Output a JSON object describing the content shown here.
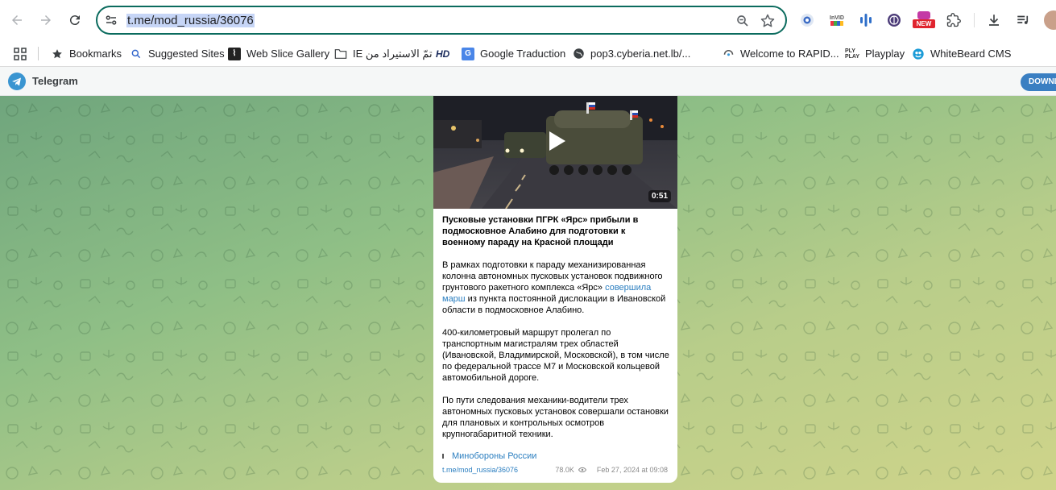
{
  "browser": {
    "url": "t.me/mod_russia/36076",
    "extensions": [
      "target-icon",
      "invid-icon",
      "audio-bars-icon",
      "tor-icon",
      "new-badge-icon",
      "puzzle-icon"
    ],
    "new_badge": "NEW",
    "invid_label": "InVID"
  },
  "bookmarks": [
    {
      "label": "Bookmarks",
      "icon": "star-icon"
    },
    {
      "label": "Suggested Sites",
      "icon": "search-icon"
    },
    {
      "label": "Web Slice Gallery",
      "icon": "slice-icon"
    },
    {
      "label": "تمّ الاستيراد من IE",
      "icon": "folder-icon"
    },
    {
      "label": "",
      "icon": "hd-icon",
      "badge": "HD"
    },
    {
      "label": "Google Traduction",
      "icon": "translate-icon"
    },
    {
      "label": "pop3.cyberia.net.lb/...",
      "icon": "globe-icon"
    },
    {
      "label": "Welcome to RAPID...",
      "icon": "rapid-icon"
    },
    {
      "label": "Playplay",
      "icon": "playplay-icon"
    },
    {
      "label": "WhiteBeard CMS",
      "icon": "whitebeard-icon"
    }
  ],
  "telegram": {
    "brand": "Telegram",
    "download": "DOWNLOAD"
  },
  "post": {
    "duration": "0:51",
    "title": "Пусковые установки ПГРК «Ярс» прибыли в подмосковное Алабино для подготовки к военному параду на Красной площади",
    "p1_before": "В рамках подготовки к параду механизированная колонна автономных пусковых установок подвижного грунтового ракетного комплекса «Ярс» ",
    "p1_link": "совершила марш",
    "p1_after": " из пункта постоянной дислокации в Ивановской области в подмосковное Алабино.",
    "p2": "400-километровый маршрут пролегал по транспортным магистралям трех областей (Ивановской, Владимирской, Московской), в том числе по федеральной трассе М7 и Московской кольцевой автомобильной дороге.",
    "p3": "По пути следования механики-водители трех автономных пусковых установок совершали остановки для плановых и контрольных осмотров крупногабаритной техники.",
    "channel_name": "Минобороны России",
    "link": "t.me/mod_russia/36076",
    "views": "78.0K",
    "date": "Feb 27, 2024 at 09:08"
  }
}
